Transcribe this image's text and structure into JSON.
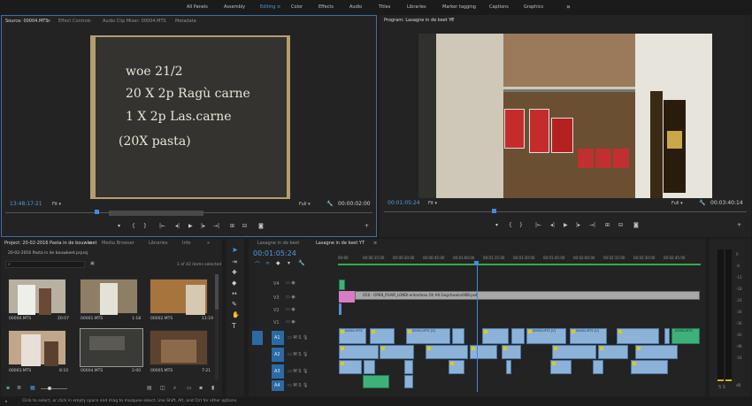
{
  "top": {
    "workspaces": [
      "All Panels",
      "Assembly",
      "Editing",
      "Color",
      "Effects",
      "Audio",
      "Titles",
      "Libraries",
      "Marker tagging",
      "Captions",
      "Graphics"
    ],
    "active": "Editing",
    "more_icon": "»"
  },
  "source": {
    "tabs": [
      "Source: 00004.MTS",
      "Effect Controls",
      "Audio Clip Mixer: 00004.MTS",
      "Metadata"
    ],
    "chalk": [
      "woe 21/2",
      "20 X 2p Ragù carne",
      "1 X 2p Las.carne",
      "(20X pasta)"
    ],
    "tc_left": "13:48:17:21",
    "fit": "Fit",
    "full": "Full",
    "tc_right": "00:00:02:00"
  },
  "program": {
    "tab": "Program: Lasagne in de keet YT",
    "tc_left": "00:01:05:24",
    "fit": "Fit",
    "full": "Full",
    "tc_right": "00:03:40:14"
  },
  "project": {
    "tabs": [
      "Project: 20-02-2016 Pasta in de bouwkeet",
      "Media Browser",
      "Libraries",
      "Info"
    ],
    "file": "20-02-2016 Pasta in de bouwkeet.prproj",
    "selected": "1 of 42 items selected",
    "clips": [
      {
        "name": "00000.MTS",
        "dur": "20:07"
      },
      {
        "name": "00001.MTS",
        "dur": "1:18"
      },
      {
        "name": "00002.MTS",
        "dur": "11:19"
      },
      {
        "name": "00003.MTS",
        "dur": "8:10"
      },
      {
        "name": "00004.MTS",
        "dur": "2:00"
      },
      {
        "name": "00005.MTS",
        "dur": "7:21"
      }
    ]
  },
  "timeline": {
    "tabs": [
      "Lasagne in de keet",
      "Lasagne in de keet YT"
    ],
    "timecode": "00:01:05:24",
    "ruler": [
      "00:00",
      "00:00:15:00",
      "00:00:30:00",
      "00:00:45:00",
      "00:01:00:00",
      "00:01:15:00",
      "00:01:30:00",
      "00:01:45:00",
      "00:02:00:00",
      "00:02:15:00",
      "00:02:30:00",
      "00:02:45:00"
    ],
    "tracks": [
      "V4",
      "V3",
      "V2",
      "V1",
      "A1",
      "A2",
      "A3",
      "A4"
    ],
    "title_clip": "O50 - OPEN_RSAM_LONDl-ontonteau Oh Hit Gegchwalon90B.psd",
    "v1_clips": [
      "00001.MTS",
      "00001.MTS [V]",
      "00002.MTS [V]",
      "00001.MTS [V]",
      "00002.MTS"
    ]
  },
  "meter": {
    "scale": [
      "0",
      "-6",
      "-12",
      "-18",
      "-24",
      "-30",
      "-36",
      "-42",
      "-48",
      "-54",
      "dB"
    ]
  },
  "status": "Click to select, or click in empty space and drag to marquee select. Use Shift, Alt, and Ctrl for other options."
}
